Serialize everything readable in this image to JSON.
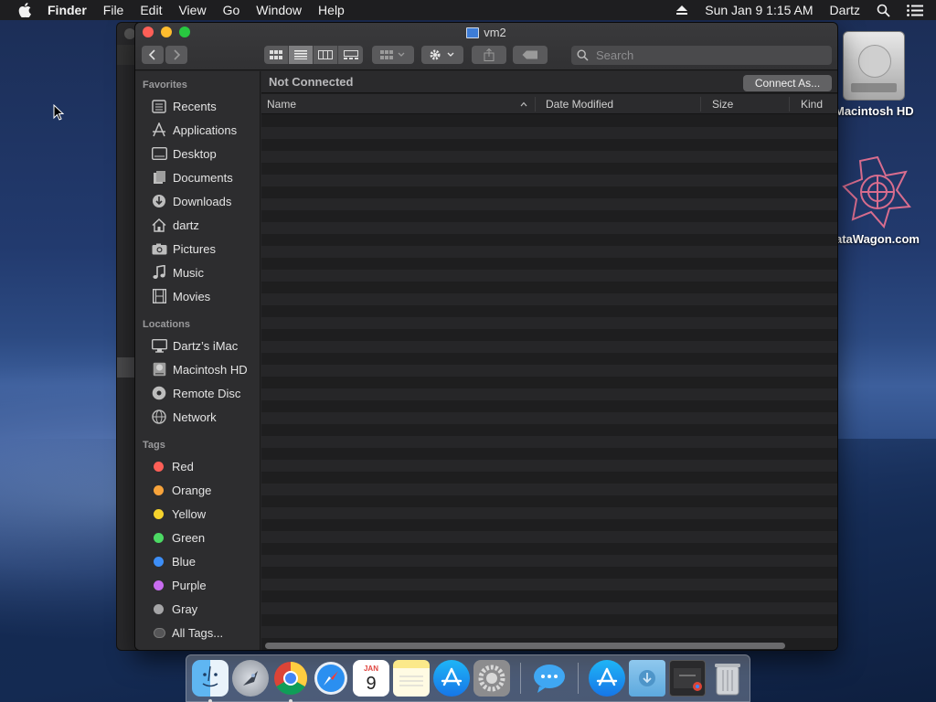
{
  "menubar": {
    "app_name": "Finder",
    "menus": [
      "File",
      "Edit",
      "View",
      "Go",
      "Window",
      "Help"
    ],
    "datetime": "Sun Jan 9  1:15 AM",
    "user": "Dartz"
  },
  "window": {
    "title": "vm2",
    "search_placeholder": "Search",
    "status": "Not Connected",
    "connect_button": "Connect As...",
    "columns": [
      "Name",
      "Date Modified",
      "Size",
      "Kind"
    ]
  },
  "sidebar": {
    "favorites_header": "Favorites",
    "favorites": [
      {
        "label": "Recents",
        "icon": "recents-icon"
      },
      {
        "label": "Applications",
        "icon": "applications-icon"
      },
      {
        "label": "Desktop",
        "icon": "desktop-icon"
      },
      {
        "label": "Documents",
        "icon": "documents-icon"
      },
      {
        "label": "Downloads",
        "icon": "downloads-icon"
      },
      {
        "label": "dartz",
        "icon": "home-icon"
      },
      {
        "label": "Pictures",
        "icon": "pictures-icon"
      },
      {
        "label": "Music",
        "icon": "music-icon"
      },
      {
        "label": "Movies",
        "icon": "movies-icon"
      }
    ],
    "locations_header": "Locations",
    "locations": [
      {
        "label": "Dartz’s iMac",
        "icon": "imac-icon"
      },
      {
        "label": "Macintosh HD",
        "icon": "hard-drive-icon"
      },
      {
        "label": "Remote Disc",
        "icon": "remote-disc-icon"
      },
      {
        "label": "Network",
        "icon": "network-icon"
      }
    ],
    "tags_header": "Tags",
    "tags": [
      {
        "label": "Red",
        "color": "#fe5f57"
      },
      {
        "label": "Orange",
        "color": "#f7a33b"
      },
      {
        "label": "Yellow",
        "color": "#f6d32d"
      },
      {
        "label": "Green",
        "color": "#4cd964"
      },
      {
        "label": "Blue",
        "color": "#3d8ef7"
      },
      {
        "label": "Purple",
        "color": "#c86cf0"
      },
      {
        "label": "Gray",
        "color": "#a5a5a7"
      },
      {
        "label": "All Tags...",
        "color": "#555557"
      }
    ]
  },
  "desktop": {
    "icons": [
      {
        "label": "Macintosh HD",
        "icon": "hard-drive-icon"
      },
      {
        "label": "ataWagon.com",
        "icon": "datawagon-logo-icon"
      }
    ]
  },
  "dock": {
    "calendar_month": "JAN",
    "calendar_day": "9"
  }
}
